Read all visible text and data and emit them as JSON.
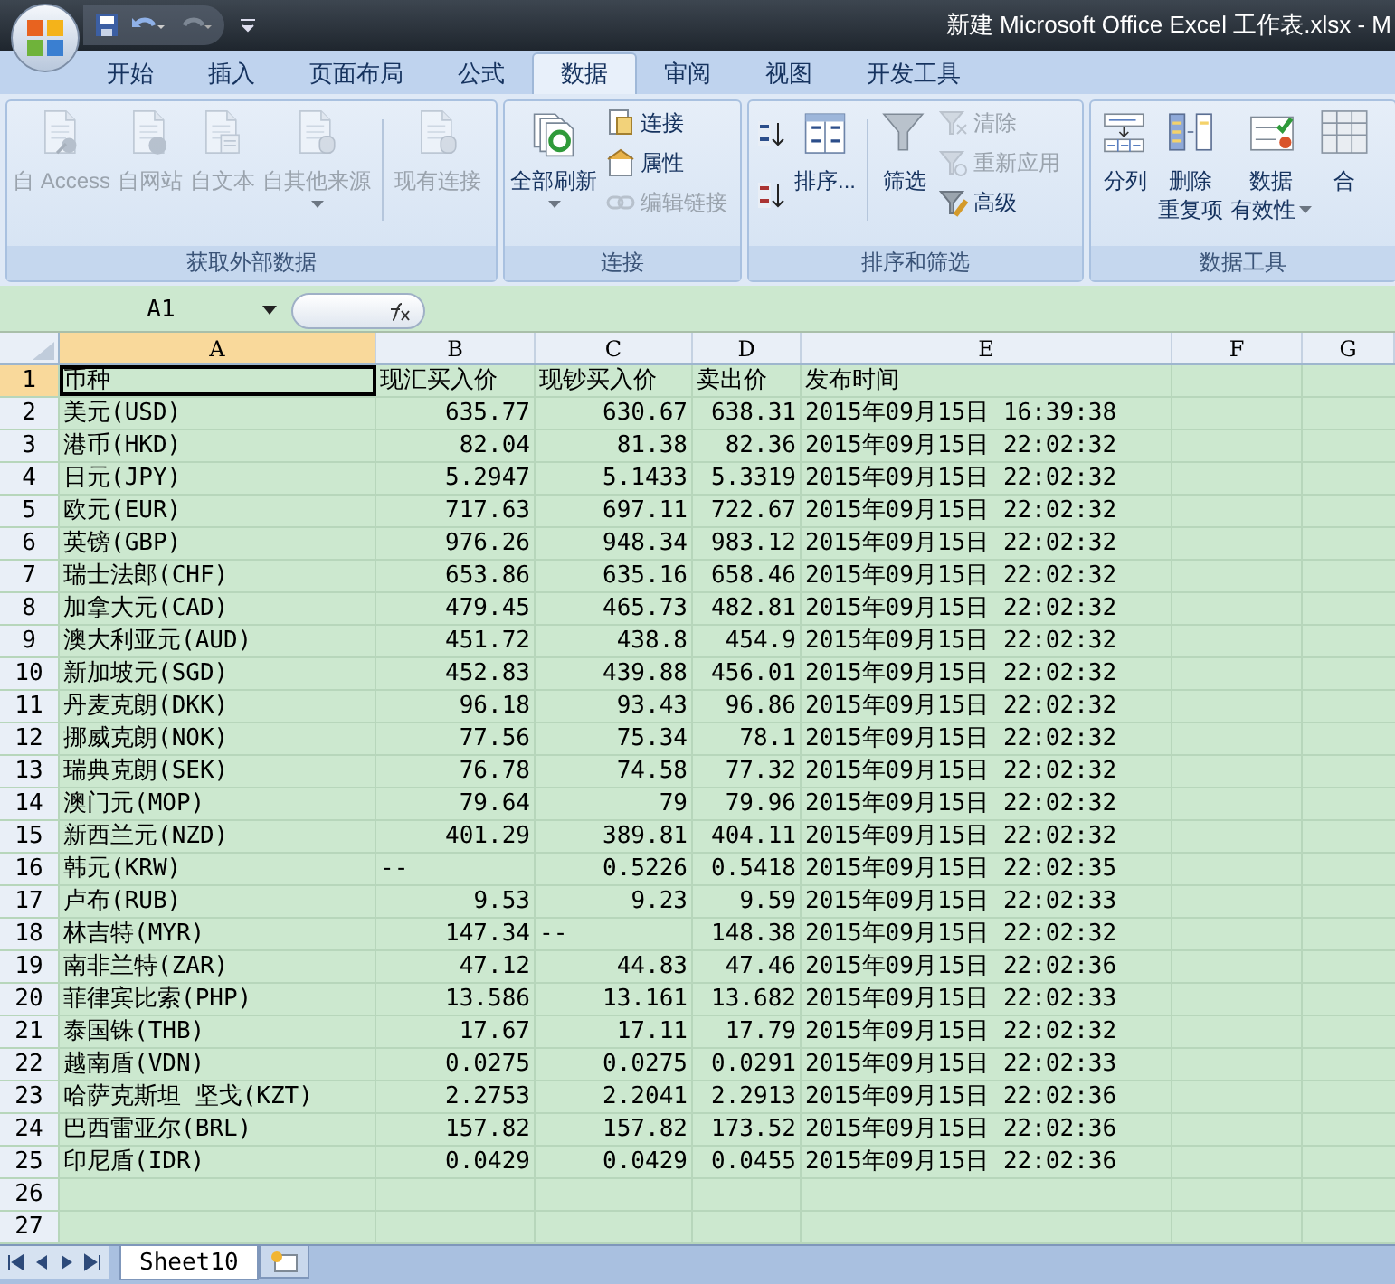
{
  "window": {
    "title": "新建 Microsoft Office Excel 工作表.xlsx - M"
  },
  "ribbon_tabs": [
    {
      "label": "开始",
      "selected": false
    },
    {
      "label": "插入",
      "selected": false
    },
    {
      "label": "页面布局",
      "selected": false
    },
    {
      "label": "公式",
      "selected": false
    },
    {
      "label": "数据",
      "selected": true
    },
    {
      "label": "审阅",
      "selected": false
    },
    {
      "label": "视图",
      "selected": false
    },
    {
      "label": "开发工具",
      "selected": false
    }
  ],
  "ribbon_groups": [
    {
      "label": "获取外部数据",
      "items": [
        {
          "kind": "large",
          "label": "自 Access",
          "disabled": true
        },
        {
          "kind": "large",
          "label": "自网站",
          "disabled": true
        },
        {
          "kind": "large",
          "label": "自文本",
          "disabled": true
        },
        {
          "kind": "large",
          "label": "自其他来源",
          "disabled": true,
          "dropdown": true
        },
        {
          "kind": "separator"
        },
        {
          "kind": "large",
          "label": "现有连接",
          "disabled": true
        }
      ]
    },
    {
      "label": "连接",
      "items": [
        {
          "kind": "large",
          "label": "全部刷新",
          "disabled": false,
          "dropdown": true
        },
        {
          "kind": "stack",
          "items": [
            {
              "label": "连接",
              "disabled": false
            },
            {
              "label": "属性",
              "disabled": false
            },
            {
              "label": "编辑链接",
              "disabled": true
            }
          ]
        }
      ]
    },
    {
      "label": "排序和筛选",
      "items": [
        {
          "kind": "stack",
          "items": [
            {
              "disabled": false
            },
            {
              "disabled": false
            }
          ]
        },
        {
          "kind": "large",
          "label": "排序...",
          "disabled": false
        },
        {
          "kind": "separator"
        },
        {
          "kind": "large",
          "label": "筛选",
          "disabled": false
        },
        {
          "kind": "stack",
          "items": [
            {
              "label": "清除",
              "disabled": true
            },
            {
              "label": "重新应用",
              "disabled": true
            },
            {
              "label": "高级",
              "disabled": false
            }
          ]
        }
      ]
    },
    {
      "label": "数据工具",
      "items": [
        {
          "kind": "large",
          "label": "分列",
          "disabled": false
        },
        {
          "kind": "large",
          "label": [
            "删除",
            "重复项"
          ],
          "disabled": false
        },
        {
          "kind": "large",
          "label": [
            "数据",
            "有效性"
          ],
          "disabled": false,
          "dropdown": true
        },
        {
          "kind": "large",
          "label": "合",
          "disabled": false
        }
      ]
    }
  ],
  "name_box": {
    "value": "A1"
  },
  "columns": [
    {
      "label": "A",
      "selected": true
    },
    {
      "label": "B",
      "selected": false
    },
    {
      "label": "C",
      "selected": false
    },
    {
      "label": "D",
      "selected": false
    },
    {
      "label": "E",
      "selected": false
    },
    {
      "label": "F",
      "selected": false
    },
    {
      "label": "G",
      "selected": false
    }
  ],
  "rows": [
    {
      "row": "1",
      "selected": true,
      "kind": "text",
      "cells": [
        "币种",
        "现汇买入价",
        "现钞买入价",
        "卖出价",
        "发布时间"
      ]
    },
    {
      "row": "2",
      "selected": false,
      "cells": [
        "美元(USD)",
        "635.77",
        "630.67",
        "638.31",
        "2015年09月15日 16:39:38"
      ]
    },
    {
      "row": "3",
      "selected": false,
      "cells": [
        "港币(HKD)",
        "82.04",
        "81.38",
        "82.36",
        "2015年09月15日 22:02:32"
      ]
    },
    {
      "row": "4",
      "selected": false,
      "cells": [
        "日元(JPY)",
        "5.2947",
        "5.1433",
        "5.3319",
        "2015年09月15日 22:02:32"
      ]
    },
    {
      "row": "5",
      "selected": false,
      "cells": [
        "欧元(EUR)",
        "717.63",
        "697.11",
        "722.67",
        "2015年09月15日 22:02:32"
      ]
    },
    {
      "row": "6",
      "selected": false,
      "cells": [
        "英镑(GBP)",
        "976.26",
        "948.34",
        "983.12",
        "2015年09月15日 22:02:32"
      ]
    },
    {
      "row": "7",
      "selected": false,
      "cells": [
        "瑞士法郎(CHF)",
        "653.86",
        "635.16",
        "658.46",
        "2015年09月15日 22:02:32"
      ]
    },
    {
      "row": "8",
      "selected": false,
      "cells": [
        "加拿大元(CAD)",
        "479.45",
        "465.73",
        "482.81",
        "2015年09月15日 22:02:32"
      ]
    },
    {
      "row": "9",
      "selected": false,
      "cells": [
        "澳大利亚元(AUD)",
        "451.72",
        "438.8",
        "454.9",
        "2015年09月15日 22:02:32"
      ]
    },
    {
      "row": "10",
      "selected": false,
      "cells": [
        "新加坡元(SGD)",
        "452.83",
        "439.88",
        "456.01",
        "2015年09月15日 22:02:32"
      ]
    },
    {
      "row": "11",
      "selected": false,
      "cells": [
        "丹麦克朗(DKK)",
        "96.18",
        "93.43",
        "96.86",
        "2015年09月15日 22:02:32"
      ]
    },
    {
      "row": "12",
      "selected": false,
      "cells": [
        "挪威克朗(NOK)",
        "77.56",
        "75.34",
        "78.1",
        "2015年09月15日 22:02:32"
      ]
    },
    {
      "row": "13",
      "selected": false,
      "cells": [
        "瑞典克朗(SEK)",
        "76.78",
        "74.58",
        "77.32",
        "2015年09月15日 22:02:32"
      ]
    },
    {
      "row": "14",
      "selected": false,
      "cells": [
        "澳门元(MOP)",
        "79.64",
        "79",
        "79.96",
        "2015年09月15日 22:02:32"
      ]
    },
    {
      "row": "15",
      "selected": false,
      "cells": [
        "新西兰元(NZD)",
        "401.29",
        "389.81",
        "404.11",
        "2015年09月15日 22:02:32"
      ]
    },
    {
      "row": "16",
      "selected": false,
      "cells": [
        "韩元(KRW)",
        {
          "text": "--",
          "kind": "text"
        },
        "0.5226",
        "0.5418",
        "2015年09月15日 22:02:35"
      ]
    },
    {
      "row": "17",
      "selected": false,
      "cells": [
        "卢布(RUB)",
        "9.53",
        "9.23",
        "9.59",
        "2015年09月15日 22:02:33"
      ]
    },
    {
      "row": "18",
      "selected": false,
      "cells": [
        "林吉特(MYR)",
        "147.34",
        {
          "text": "--",
          "kind": "text"
        },
        "148.38",
        "2015年09月15日 22:02:32"
      ]
    },
    {
      "row": "19",
      "selected": false,
      "cells": [
        "南非兰特(ZAR)",
        "47.12",
        "44.83",
        "47.46",
        "2015年09月15日 22:02:36"
      ]
    },
    {
      "row": "20",
      "selected": false,
      "cells": [
        "菲律宾比索(PHP)",
        "13.586",
        "13.161",
        "13.682",
        "2015年09月15日 22:02:33"
      ]
    },
    {
      "row": "21",
      "selected": false,
      "cells": [
        "泰国铢(THB)",
        "17.67",
        "17.11",
        "17.79",
        "2015年09月15日 22:02:32"
      ]
    },
    {
      "row": "22",
      "selected": false,
      "cells": [
        "越南盾(VDN)",
        "0.0275",
        "0.0275",
        "0.0291",
        "2015年09月15日 22:02:33"
      ]
    },
    {
      "row": "23",
      "selected": false,
      "cells": [
        "哈萨克斯坦 坚戈(KZT)",
        "2.2753",
        "2.2041",
        "2.2913",
        "2015年09月15日 22:02:36"
      ]
    },
    {
      "row": "24",
      "selected": false,
      "cells": [
        "巴西雷亚尔(BRL)",
        "157.82",
        "157.82",
        "173.52",
        "2015年09月15日 22:02:36"
      ]
    },
    {
      "row": "25",
      "selected": false,
      "cells": [
        "印尼盾(IDR)",
        "0.0429",
        "0.0429",
        "0.0455",
        "2015年09月15日 22:02:36"
      ]
    },
    {
      "row": "26",
      "selected": false
    },
    {
      "row": "27",
      "selected": false
    }
  ],
  "sheet_tabs": [
    {
      "label": "Sheet10",
      "selected": true
    }
  ]
}
